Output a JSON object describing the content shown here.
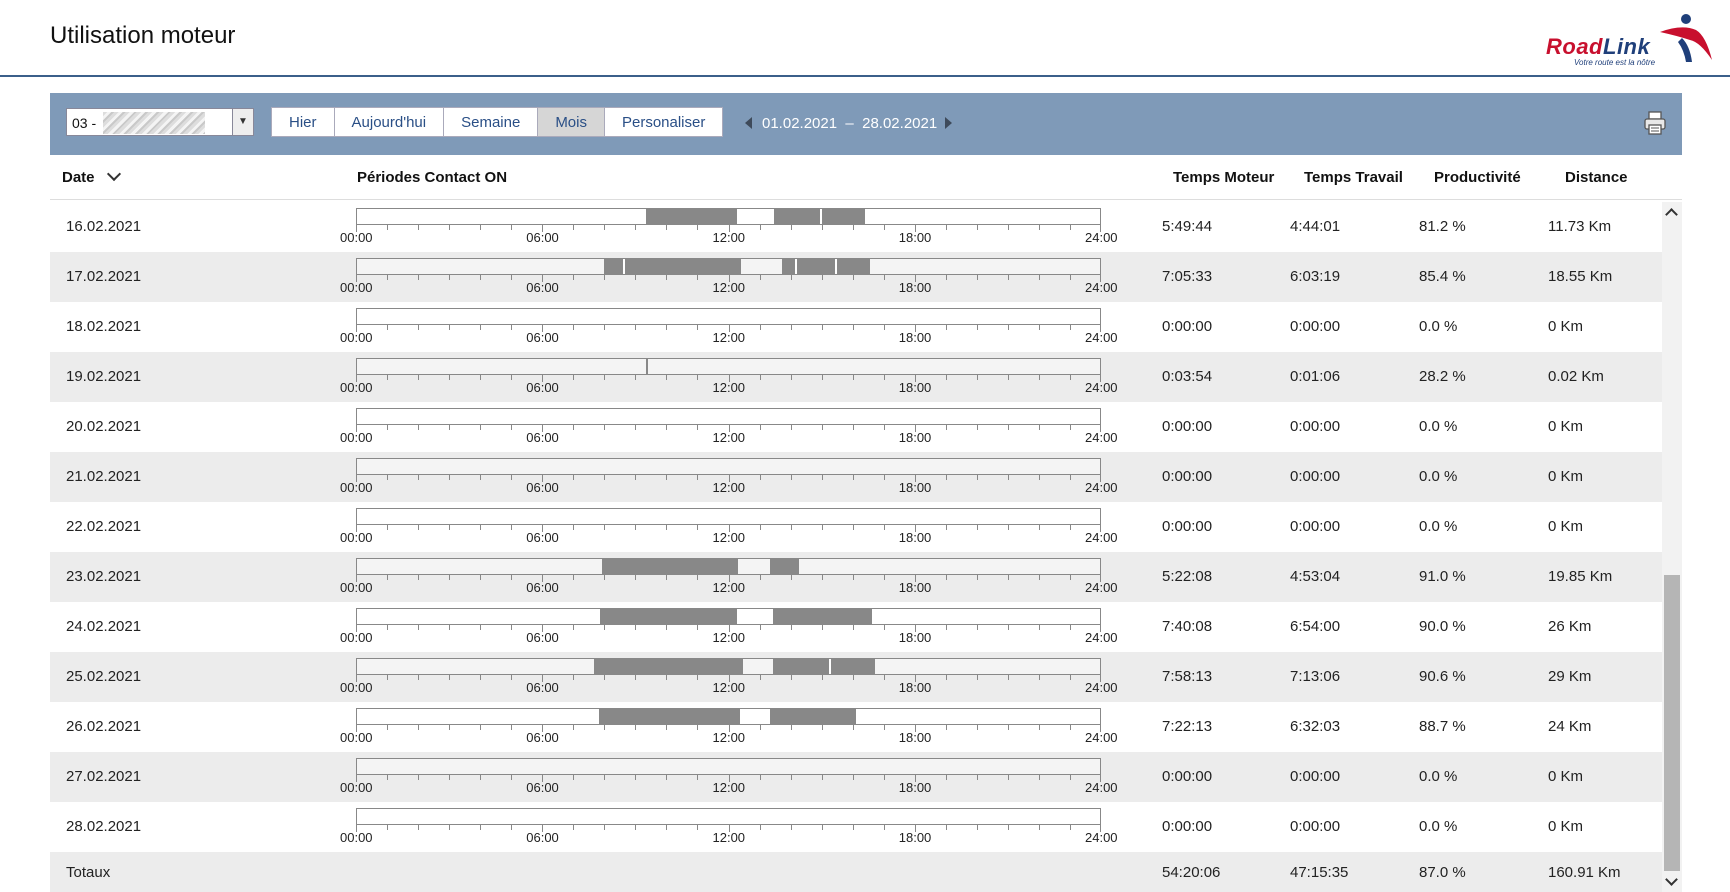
{
  "header": {
    "title": "Utilisation moteur"
  },
  "logo": {
    "word1": "Road",
    "word2": "Link",
    "tagline": "Votre route est la nôtre"
  },
  "toolbar": {
    "vehicle_value": "03 -",
    "buttons": [
      "Hier",
      "Aujourd'hui",
      "Semaine",
      "Mois",
      "Personaliser"
    ],
    "active_button": "Mois",
    "date_from": "01.02.2021",
    "date_sep": "–",
    "date_to": "28.02.2021"
  },
  "table": {
    "headers": {
      "date": "Date",
      "periods": "Périodes Contact ON",
      "motor": "Temps Moteur",
      "work": "Temps Travail",
      "prod": "Productivité",
      "dist": "Distance"
    },
    "tick_labels": [
      "00:00",
      "06:00",
      "12:00",
      "18:00",
      "24:00"
    ],
    "rows": [
      {
        "date": "16.02.2021",
        "motor": "5:49:44",
        "work": "4:44:01",
        "prod": "81.2 %",
        "dist": "11.73 Km",
        "periods": [
          [
            9.33,
            12.27
          ],
          [
            13.47,
            16.4
          ]
        ],
        "gaps": [
          14.97
        ]
      },
      {
        "date": "17.02.2021",
        "motor": "7:05:33",
        "work": "6:03:19",
        "prod": "85.4 %",
        "dist": "18.55 Km",
        "periods": [
          [
            7.97,
            12.42
          ],
          [
            13.72,
            16.57
          ]
        ],
        "gaps": [
          8.6,
          14.15,
          15.45
        ]
      },
      {
        "date": "18.02.2021",
        "motor": "0:00:00",
        "work": "0:00:00",
        "prod": "0.0 %",
        "dist": "0 Km",
        "periods": [],
        "gaps": []
      },
      {
        "date": "19.02.2021",
        "motor": "0:03:54",
        "work": "0:01:06",
        "prod": "28.2 %",
        "dist": "0.02 Km",
        "periods": [
          [
            9.33,
            9.4
          ]
        ],
        "gaps": []
      },
      {
        "date": "20.02.2021",
        "motor": "0:00:00",
        "work": "0:00:00",
        "prod": "0.0 %",
        "dist": "0 Km",
        "periods": [],
        "gaps": []
      },
      {
        "date": "21.02.2021",
        "motor": "0:00:00",
        "work": "0:00:00",
        "prod": "0.0 %",
        "dist": "0 Km",
        "periods": [],
        "gaps": []
      },
      {
        "date": "22.02.2021",
        "motor": "0:00:00",
        "work": "0:00:00",
        "prod": "0.0 %",
        "dist": "0 Km",
        "periods": [],
        "gaps": []
      },
      {
        "date": "23.02.2021",
        "motor": "5:22:08",
        "work": "4:53:04",
        "prod": "91.0 %",
        "dist": "19.85 Km",
        "periods": [
          [
            7.92,
            12.3
          ],
          [
            13.35,
            14.27
          ]
        ],
        "gaps": []
      },
      {
        "date": "24.02.2021",
        "motor": "7:40:08",
        "work": "6:54:00",
        "prod": "90.0 %",
        "dist": "26 Km",
        "periods": [
          [
            7.85,
            12.27
          ],
          [
            13.45,
            16.62
          ]
        ],
        "gaps": []
      },
      {
        "date": "25.02.2021",
        "motor": "7:58:13",
        "work": "7:13:06",
        "prod": "90.6 %",
        "dist": "29 Km",
        "periods": [
          [
            7.67,
            12.47
          ],
          [
            13.45,
            16.72
          ]
        ],
        "gaps": [
          15.25
        ]
      },
      {
        "date": "26.02.2021",
        "motor": "7:22:13",
        "work": "6:32:03",
        "prod": "88.7 %",
        "dist": "24 Km",
        "periods": [
          [
            7.82,
            12.38
          ],
          [
            13.33,
            16.13
          ]
        ],
        "gaps": []
      },
      {
        "date": "27.02.2021",
        "motor": "0:00:00",
        "work": "0:00:00",
        "prod": "0.0 %",
        "dist": "0 Km",
        "periods": [],
        "gaps": []
      },
      {
        "date": "28.02.2021",
        "motor": "0:00:00",
        "work": "0:00:00",
        "prod": "0.0 %",
        "dist": "0 Km",
        "periods": [],
        "gaps": []
      }
    ],
    "totals": {
      "label": "Totaux",
      "motor": "54:20:06",
      "work": "47:15:35",
      "prod": "87.0 %",
      "dist": "160.91 Km"
    }
  }
}
